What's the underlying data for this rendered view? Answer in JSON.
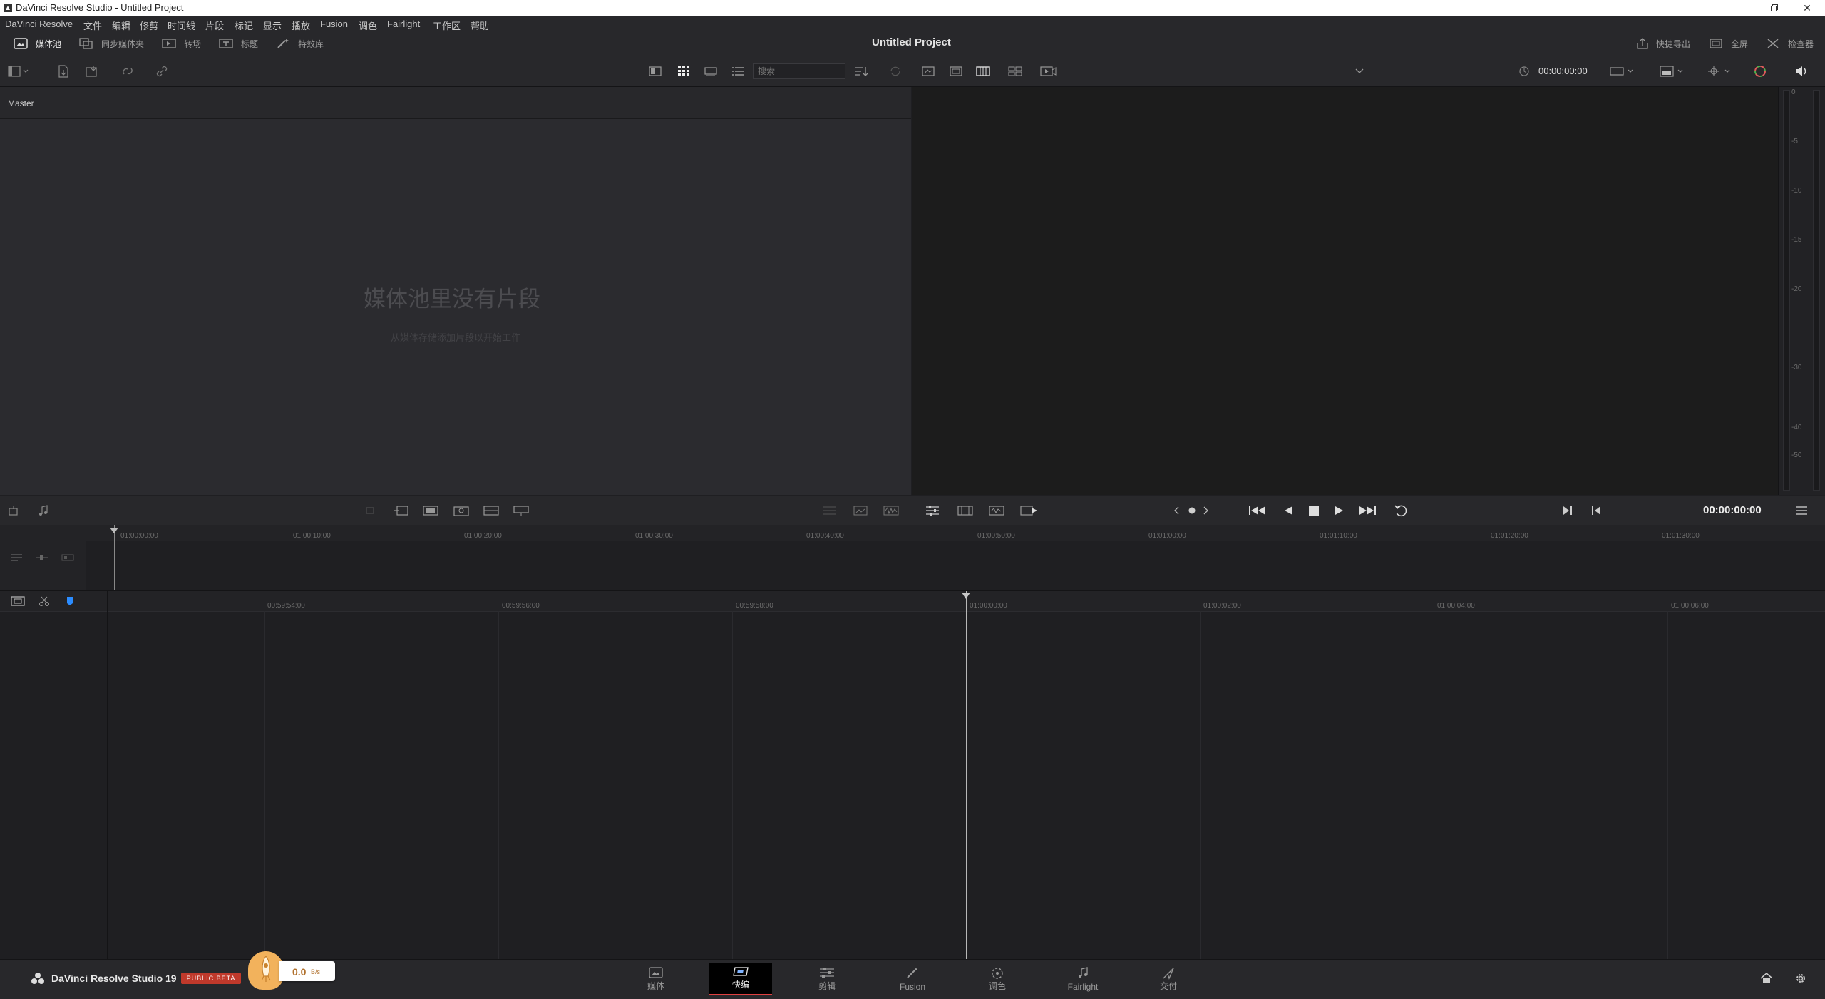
{
  "window": {
    "title": "DaVinci Resolve Studio - Untitled Project"
  },
  "menu": [
    "DaVinci Resolve",
    "文件",
    "编辑",
    "修剪",
    "时间线",
    "片段",
    "标记",
    "显示",
    "播放",
    "Fusion",
    "调色",
    "Fairlight",
    "工作区",
    "帮助"
  ],
  "toolbar": {
    "left": [
      "媒体池",
      "同步媒体夹",
      "转场",
      "标题",
      "特效库"
    ],
    "project_title": "Untitled Project",
    "right": [
      "快捷导出",
      "全屏",
      "检查器"
    ]
  },
  "search": {
    "placeholder": "搜索"
  },
  "bin": {
    "name": "Master",
    "empty_title": "媒体池里没有片段",
    "empty_hint": "从媒体存储添加片段以开始工作"
  },
  "viewer": {
    "timecode_top": "00:00:00:00",
    "timecode": "00:00:00:00"
  },
  "meter": {
    "scale": [
      "0",
      "-5",
      "-10",
      "-15",
      "-20",
      "-30",
      "-40",
      "-50"
    ]
  },
  "upper_ruler": [
    "01:00:00:00",
    "01:00:10:00",
    "01:00:20:00",
    "01:00:30:00",
    "01:00:40:00",
    "01:00:50:00",
    "01:01:00:00",
    "01:01:10:00",
    "01:01:20:00",
    "01:01:30:00"
  ],
  "lower_ruler": [
    "00:59:54:00",
    "00:59:56:00",
    "00:59:58:00",
    "01:00:00:00",
    "01:00:02:00",
    "01:00:04:00",
    "01:00:06:00"
  ],
  "footer": {
    "app_name": "DaVinci Resolve Studio 19",
    "badge": "PUBLIC BETA",
    "speed": "0.0",
    "speed_unit": "B/s",
    "pages": [
      "媒体",
      "快编",
      "剪辑",
      "Fusion",
      "调色",
      "Fairlight",
      "交付"
    ],
    "active_page": "快编"
  },
  "colors": {
    "accent": "#e04040",
    "badge": "#c0392b",
    "marker": "#2b8cff",
    "speed": "#f2b25c"
  }
}
